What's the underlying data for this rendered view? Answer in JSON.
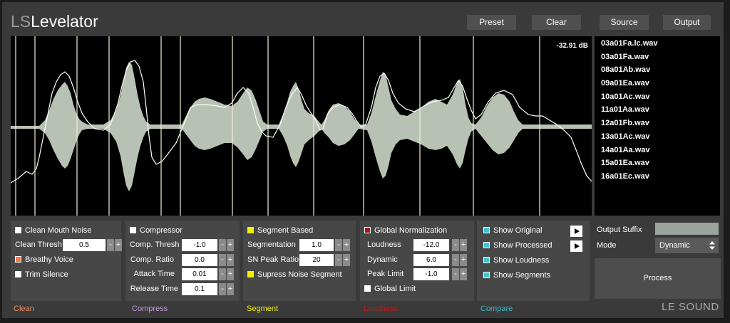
{
  "app": {
    "title_ls": "LS",
    "title_rest": "Levelator",
    "brand": "LE SOUND"
  },
  "toolbar": {
    "preset": "Preset",
    "clear": "Clear",
    "source": "Source",
    "output": "Output"
  },
  "waveform": {
    "db_readout": "-32.91 dB"
  },
  "files": [
    "03a01Fa.lc.wav",
    "03a01Fa.wav",
    "08a01Ab.wav",
    "09a01Ea.wav",
    "10a01Ac.wav",
    "11a01Aa.wav",
    "12a01Fb.wav",
    "13a01Ac.wav",
    "14a01Aa.wav",
    "15a01Ea.wav",
    "16a01Ec.wav"
  ],
  "clean": {
    "mouth_noise": "Clean Mouth Noise",
    "thresh_label": "Clean Thresh",
    "thresh_value": "0.5",
    "breathy": "Breathy Voice",
    "trim": "Trim Silence"
  },
  "compress": {
    "compressor": "Compressor",
    "thresh_label": "Comp. Thresh",
    "thresh_value": "-1.0",
    "ratio_label": "Comp. Ratio",
    "ratio_value": "0.0",
    "attack_label": "Attack Time",
    "attack_value": "0.01",
    "release_label": "Release Time",
    "release_value": "0.1"
  },
  "segment": {
    "based": "Segment Based",
    "segmentation_label": "Segmentation",
    "segmentation_value": "1.0",
    "sn_label": "SN Peak Ratio",
    "sn_value": "20",
    "suppress": "Supress Noise Segment"
  },
  "loudness": {
    "global_norm": "Global Normalization",
    "loudness_label": "Loudness",
    "loudness_value": "-12.0",
    "dynamic_label": "Dynamic",
    "dynamic_value": "6.0",
    "peak_label": "Peak Limit",
    "peak_value": "-1.0",
    "global_limit": "Global Limit"
  },
  "compare": {
    "original": "Show Original",
    "processed": "Show Processed",
    "loudness": "Show Loudness",
    "segments": "Show Segments"
  },
  "output": {
    "suffix_label": "Output Suffix",
    "suffix_value": "",
    "mode_label": "Mode",
    "mode_value": "Dynamic",
    "process": "Process"
  },
  "footer": {
    "clean": "Clean",
    "compress": "Compress",
    "segment": "Segment",
    "loudness": "Loudness",
    "compare": "Compare"
  },
  "stepper": {
    "minus": "-",
    "plus": "+"
  },
  "colors": {
    "clean": "#f08a5a",
    "compress": "#c89ad8",
    "segment": "#f0f000",
    "loudness": "#b01e1e",
    "compare": "#30c0c8",
    "panel_bg": "#474747",
    "app_bg": "#3a3a3a",
    "wave_fill": "#b8c2b4"
  }
}
